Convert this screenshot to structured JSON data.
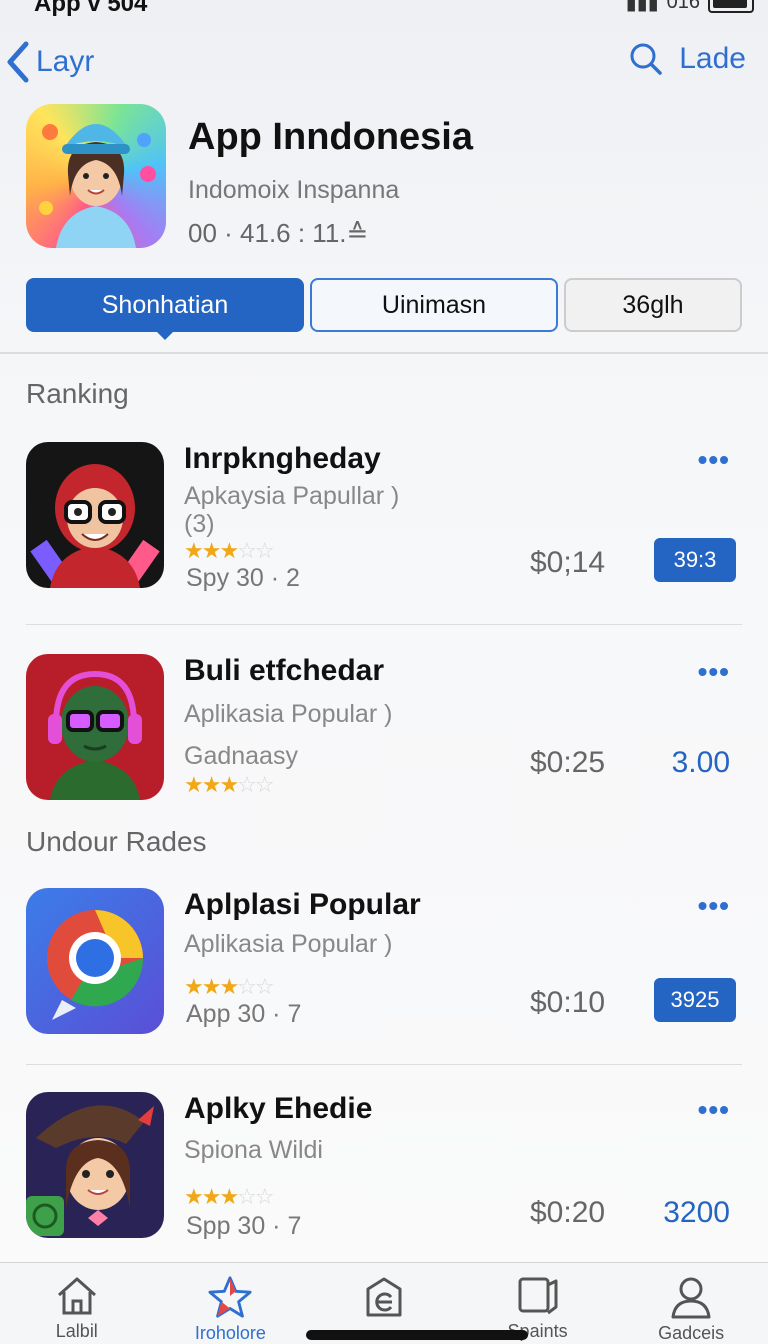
{
  "status": {
    "left": "App v 504",
    "right": "016"
  },
  "nav": {
    "back_label": "Layr",
    "right_label": "Lade"
  },
  "app": {
    "title": "App Inndonesia",
    "subtitle": "Indomoix Inspanna",
    "meta": "00 · 41.6 : 11.≙"
  },
  "segments": [
    "Shonhatian",
    "Uinimasn",
    "36glh"
  ],
  "sections": {
    "ranking": "Ranking",
    "second": "Undour Rades"
  },
  "rows": [
    {
      "name": "Inrpkngheday",
      "category": "Apkaysia Papullar )",
      "extra": "(3)",
      "rating": 3,
      "meta": "Spy 30 · 2",
      "price": "$0;14",
      "action": "39:3",
      "action_style": "button",
      "more": "•••"
    },
    {
      "name": "Buli etfchedar",
      "category": "Aplikasia Popular )",
      "extra": "Gadnaasy",
      "rating": 3,
      "meta": "",
      "price": "$0:25",
      "action": "3.00",
      "action_style": "text",
      "more": "•••"
    },
    {
      "name": "Aplplasi Popular",
      "category": "Aplikasia Popular )",
      "extra": "",
      "rating": 3,
      "meta": "App 30 · 7",
      "price": "$0:10",
      "action": "3925",
      "action_style": "button",
      "more": "•••"
    },
    {
      "name": "Aplky Ehedie",
      "category": "Spiona Wildi",
      "extra": "",
      "rating": 3,
      "meta": "Spp 30 · 7",
      "price": "$0:20",
      "action": "3200",
      "action_style": "text",
      "more": "•••"
    }
  ],
  "tabs": [
    {
      "label": "Lalbil",
      "icon": "home-icon"
    },
    {
      "label": "Iroholore",
      "icon": "star-icon"
    },
    {
      "label": "",
      "icon": "apps-icon"
    },
    {
      "label": "Spaints",
      "icon": "book-icon"
    },
    {
      "label": "Gadceis",
      "icon": "person-icon"
    }
  ]
}
